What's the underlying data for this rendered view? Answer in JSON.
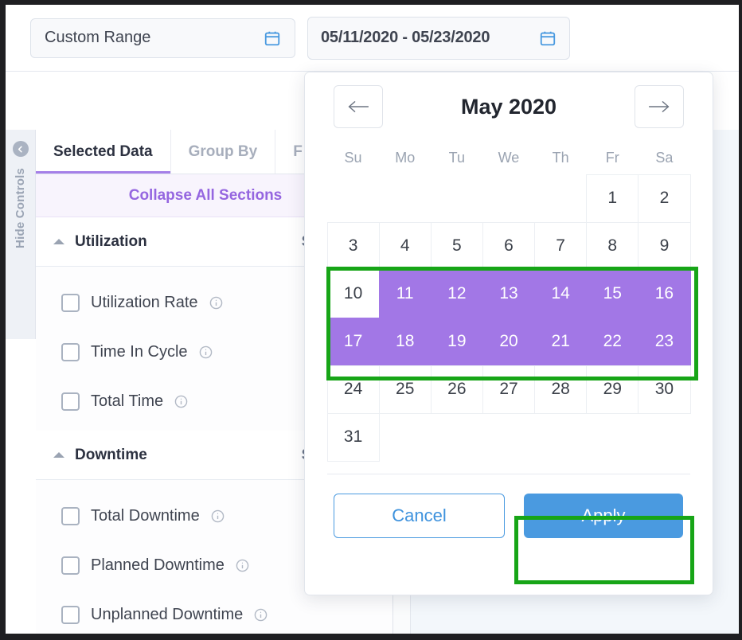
{
  "toolbar": {
    "range_mode": "Custom Range",
    "range_value": "05/11/2020 - 05/23/2020",
    "calendar_icon": "calendar-icon"
  },
  "rail": {
    "label": "Hide Controls",
    "icon": "chevron-left-circle-icon"
  },
  "controls": {
    "tabs": [
      {
        "label": "Selected Data",
        "active": true
      },
      {
        "label": "Group By",
        "active": false
      },
      {
        "label": "F",
        "active": false
      }
    ],
    "collapse_all": "Collapse All Sections",
    "sections": [
      {
        "title": "Utilization",
        "select_all": "Select All",
        "separator": "/",
        "items": [
          {
            "label": "Utilization Rate",
            "checked": false,
            "info": "info-icon"
          },
          {
            "label": "Time In Cycle",
            "checked": false,
            "info": "info-icon"
          },
          {
            "label": "Total Time",
            "checked": false,
            "info": "info-icon"
          }
        ]
      },
      {
        "title": "Downtime",
        "select_all": "Select All",
        "separator": "/",
        "items": [
          {
            "label": "Total Downtime",
            "checked": false,
            "info": "info-icon"
          },
          {
            "label": "Planned Downtime",
            "checked": false,
            "info": "info-icon"
          },
          {
            "label": "Unplanned Downtime",
            "checked": false,
            "info": "info-icon"
          }
        ]
      }
    ]
  },
  "calendar": {
    "prev_icon": "arrow-left-icon",
    "next_icon": "arrow-right-icon",
    "month_title": "May 2020",
    "weekdays": [
      "Su",
      "Mo",
      "Tu",
      "We",
      "Th",
      "Fr",
      "Sa"
    ],
    "leading_blanks": 5,
    "days": [
      {
        "n": "1",
        "selected": false
      },
      {
        "n": "2",
        "selected": false
      },
      {
        "n": "3",
        "selected": false
      },
      {
        "n": "4",
        "selected": false
      },
      {
        "n": "5",
        "selected": false
      },
      {
        "n": "6",
        "selected": false
      },
      {
        "n": "7",
        "selected": false
      },
      {
        "n": "8",
        "selected": false
      },
      {
        "n": "9",
        "selected": false
      },
      {
        "n": "10",
        "selected": false
      },
      {
        "n": "11",
        "selected": true
      },
      {
        "n": "12",
        "selected": true
      },
      {
        "n": "13",
        "selected": true
      },
      {
        "n": "14",
        "selected": true
      },
      {
        "n": "15",
        "selected": true
      },
      {
        "n": "16",
        "selected": true
      },
      {
        "n": "17",
        "selected": true
      },
      {
        "n": "18",
        "selected": true
      },
      {
        "n": "19",
        "selected": true
      },
      {
        "n": "20",
        "selected": true
      },
      {
        "n": "21",
        "selected": true
      },
      {
        "n": "22",
        "selected": true
      },
      {
        "n": "23",
        "selected": true
      },
      {
        "n": "24",
        "selected": false
      },
      {
        "n": "25",
        "selected": false
      },
      {
        "n": "26",
        "selected": false
      },
      {
        "n": "27",
        "selected": false
      },
      {
        "n": "28",
        "selected": false
      },
      {
        "n": "29",
        "selected": false
      },
      {
        "n": "30",
        "selected": false
      },
      {
        "n": "31",
        "selected": false
      }
    ],
    "cancel_label": "Cancel",
    "apply_label": "Apply"
  },
  "colors": {
    "selected_day": "#a277e6",
    "accent_purple": "#9566e0",
    "primary_blue": "#4a9ae0",
    "annotation_green": "#17a517"
  }
}
